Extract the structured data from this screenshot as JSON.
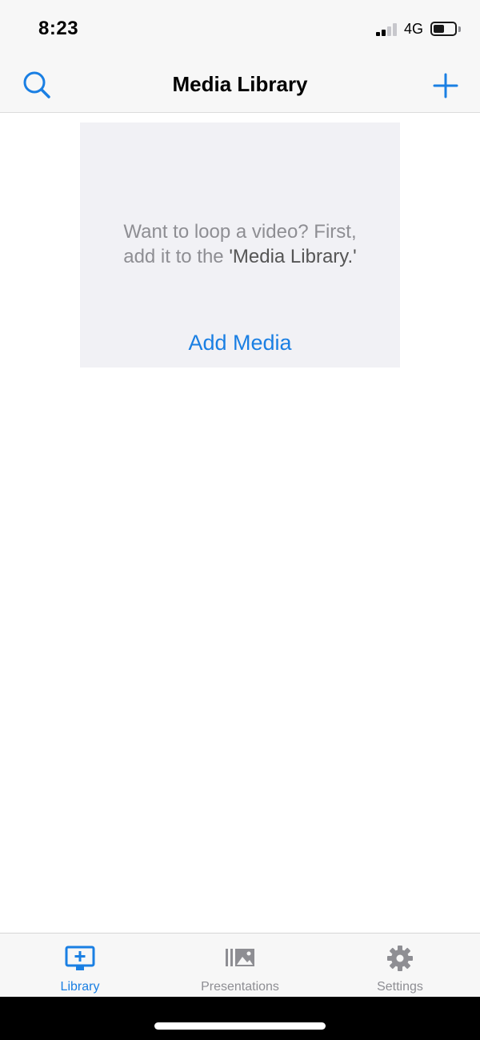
{
  "status_bar": {
    "time": "8:23",
    "network": "4G",
    "signal_bars_active": 2,
    "signal_bars_total": 4
  },
  "nav": {
    "title": "Media Library",
    "search_icon": "search-icon",
    "add_icon": "plus-icon"
  },
  "empty_state": {
    "line1": "Want to loop a video? First,",
    "line2_prefix": "add it to the ",
    "line2_emphasis": "'Media Library.'",
    "action_label": "Add Media"
  },
  "tabs": [
    {
      "label": "Library",
      "icon": "library-icon",
      "selected": true
    },
    {
      "label": "Presentations",
      "icon": "presentations-icon",
      "selected": false
    },
    {
      "label": "Settings",
      "icon": "gear-icon",
      "selected": false
    }
  ],
  "colors": {
    "accent": "#1a7fe3",
    "inactive": "#8e8e93",
    "bar_background": "#f7f7f7",
    "card_background": "#f1f1f5"
  }
}
